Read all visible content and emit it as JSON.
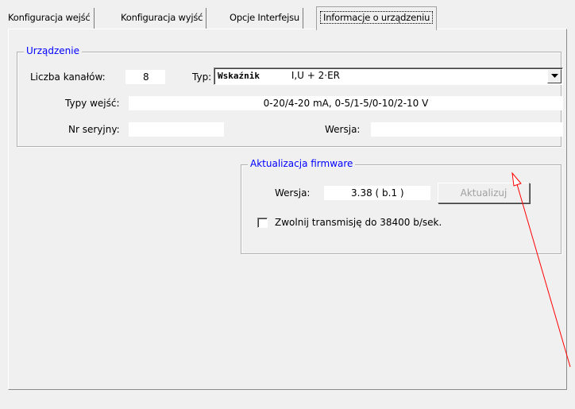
{
  "tabs": [
    {
      "label": "Konfiguracja wejść"
    },
    {
      "label": "Konfiguracja wyjść"
    },
    {
      "label": "Opcje Interfejsu"
    },
    {
      "label": "Informacje o urządzeniu",
      "active": true
    }
  ],
  "device": {
    "legend": "Urządzenie",
    "channels_label": "Liczba kanałów:",
    "channels_value": "8",
    "type_label": "Typ:",
    "type_value_prefix": "Wskaźnik",
    "type_value_suffix": "I,U + 2·ER",
    "input_types_label": "Typy wejść:",
    "input_types_value": "0-20/4-20 mA,  0-5/1-5/0-10/2-10 V",
    "serial_label": "Nr seryjny:",
    "serial_value": "",
    "version_label": "Wersja:",
    "version_value": ""
  },
  "firmware": {
    "legend": "Aktualizacja firmware",
    "version_label": "Wersja:",
    "version_value": "3.38  ( b.1 )",
    "update_button": "Aktualizuj",
    "slow_transmission_label": "Zwolnij transmisję do 38400 b/sek.",
    "slow_transmission_checked": false
  },
  "colors": {
    "legend_text": "#0000ff",
    "annotation_arrow": "#ff0000"
  }
}
